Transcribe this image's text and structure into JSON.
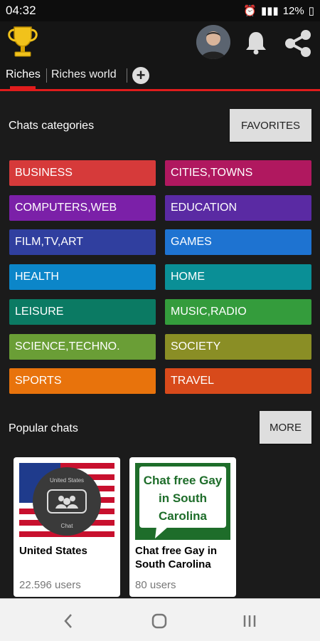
{
  "status": {
    "time": "04:32",
    "battery": "12%"
  },
  "app": {
    "icons": [
      "trophy-icon",
      "avatar",
      "bell-icon",
      "share-icon"
    ]
  },
  "tabs": [
    {
      "label": "Riches",
      "active": true
    },
    {
      "label": "Riches world",
      "active": false
    }
  ],
  "categories": {
    "title": "Chats categories",
    "favorites_label": "FAVORITES",
    "items": [
      {
        "label": "BUSINESS",
        "color": "#d63a3a"
      },
      {
        "label": "CITIES,TOWNS",
        "color": "#b0185f"
      },
      {
        "label": "COMPUTERS,WEB",
        "color": "#7b20a8"
      },
      {
        "label": "EDUCATION",
        "color": "#5a2aa3"
      },
      {
        "label": "FILM,TV,ART",
        "color": "#303f9f"
      },
      {
        "label": "GAMES",
        "color": "#1e73d1"
      },
      {
        "label": "HEALTH",
        "color": "#0c86c9"
      },
      {
        "label": "HOME",
        "color": "#0a8f96"
      },
      {
        "label": "LEISURE",
        "color": "#0b7a63"
      },
      {
        "label": "MUSIC,RADIO",
        "color": "#349c3c"
      },
      {
        "label": "SCIENCE,TECHNO.",
        "color": "#6a9e36"
      },
      {
        "label": "SOCIETY",
        "color": "#8a8e25"
      },
      {
        "label": "SPORTS",
        "color": "#e8730c"
      },
      {
        "label": "TRAVEL",
        "color": "#d84a1b"
      }
    ]
  },
  "popular": {
    "title": "Popular chats",
    "more_label": "MORE",
    "chats": [
      {
        "name": "United States",
        "users": "22.596 users",
        "badge_top": "United States",
        "badge_bottom": "Chat"
      },
      {
        "name": "Chat free Gay in South Carolina",
        "users": "80 users",
        "image_text": "Chat free Gay in South Carolina"
      }
    ]
  },
  "navbar": {
    "back": "‹",
    "home": "○",
    "recent": "|||"
  }
}
